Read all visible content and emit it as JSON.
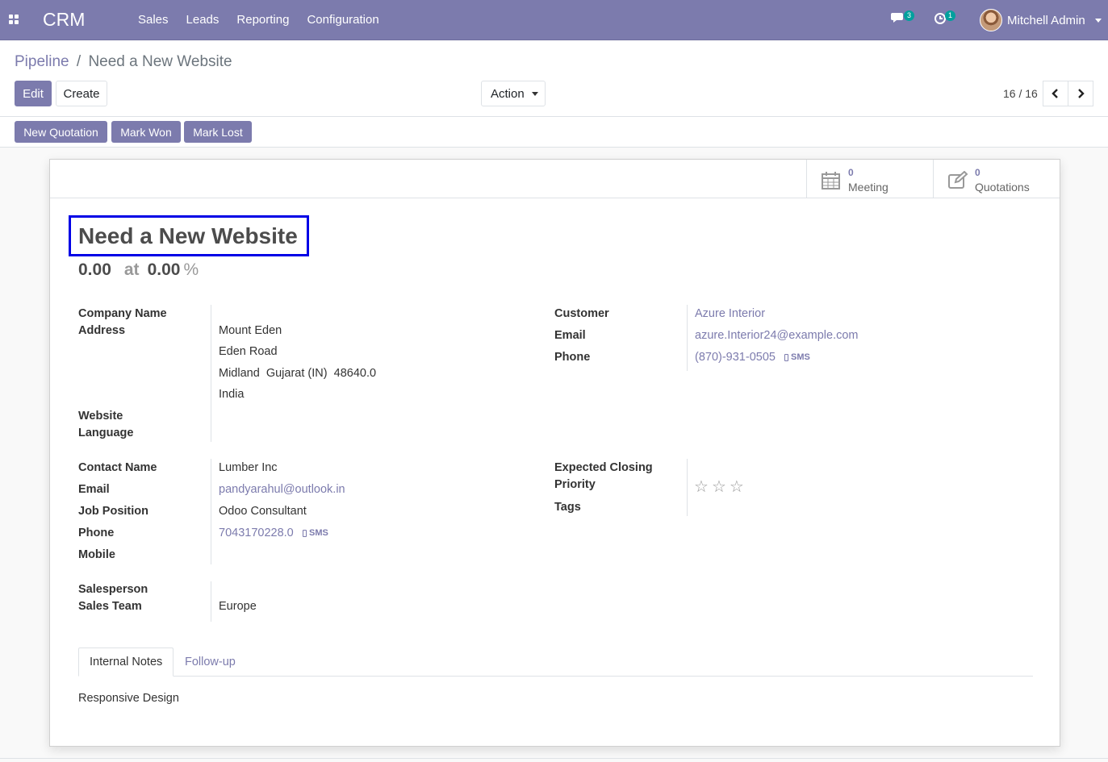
{
  "navbar": {
    "app_name": "CRM",
    "menu": [
      "Sales",
      "Leads",
      "Reporting",
      "Configuration"
    ],
    "messages_count": "3",
    "activities_count": "1",
    "user_name": "Mitchell Admin"
  },
  "breadcrumb": {
    "parent": "Pipeline",
    "separator": "/",
    "current": "Need a New Website"
  },
  "buttons": {
    "edit": "Edit",
    "create": "Create",
    "action": "Action"
  },
  "pager": {
    "value": "16 / 16"
  },
  "status_buttons": {
    "new_quotation": "New Quotation",
    "mark_won": "Mark Won",
    "mark_lost": "Mark Lost"
  },
  "stats": {
    "meeting": {
      "count": "0",
      "label": "Meeting"
    },
    "quotations": {
      "count": "0",
      "label": "Quotations"
    }
  },
  "lead": {
    "title": "Need a New Website",
    "revenue": "0.00",
    "at": "at",
    "probability": "0.00",
    "percent_sign": "%"
  },
  "labels": {
    "company_name": "Company Name",
    "address": "Address",
    "website": "Website",
    "language": "Language",
    "customer": "Customer",
    "email": "Email",
    "phone": "Phone",
    "contact_name": "Contact Name",
    "email2": "Email",
    "job_position": "Job Position",
    "phone2": "Phone",
    "mobile": "Mobile",
    "expected_closing": "Expected Closing",
    "priority": "Priority",
    "tags": "Tags",
    "salesperson": "Salesperson",
    "sales_team": "Sales Team"
  },
  "values": {
    "address_line1": "Mount Eden",
    "address_line2": "Eden Road",
    "address_line3": "Midland  Gujarat (IN)  48640.0",
    "address_line4": "India",
    "customer": "Azure Interior",
    "customer_email": "azure.Interior24@example.com",
    "customer_phone": "(870)-931-0505",
    "sms": "SMS",
    "contact_name": "Lumber Inc",
    "contact_email": "pandyarahul@outlook.in",
    "job_position": "Odoo Consultant",
    "contact_phone": "7043170228.0",
    "sales_team": "Europe",
    "priority_stars": 0
  },
  "tabs": [
    "Internal Notes",
    "Follow-up"
  ],
  "notes": "Responsive Design",
  "colors": {
    "brand": "#7c7bad",
    "badge": "#00a09d",
    "highlight": "#0000e6"
  }
}
